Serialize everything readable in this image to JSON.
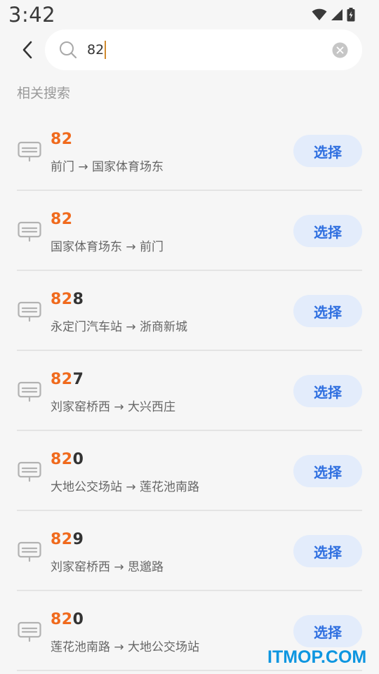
{
  "status_bar": {
    "time": "3:42"
  },
  "search": {
    "value": "82"
  },
  "section_title": "相关搜索",
  "select_label": "选择",
  "routes": [
    {
      "match": "82",
      "rest": "",
      "desc": "前门 → 国家体育场东"
    },
    {
      "match": "82",
      "rest": "",
      "desc": "国家体育场东 → 前门"
    },
    {
      "match": "82",
      "rest": "8",
      "desc": "永定门汽车站 → 浙商新城"
    },
    {
      "match": "82",
      "rest": "7",
      "desc": "刘家窑桥西 → 大兴西庄"
    },
    {
      "match": "82",
      "rest": "0",
      "desc": "大地公交场站 → 莲花池南路"
    },
    {
      "match": "82",
      "rest": "9",
      "desc": "刘家窑桥西 → 思邈路"
    },
    {
      "match": "82",
      "rest": "0",
      "desc": "莲花池南路 → 大地公交场站"
    }
  ],
  "watermark": "ITMOP.COM",
  "colors": {
    "highlight": "#f06a1d",
    "button_bg": "#e3ecfb",
    "button_text": "#2f6fe0",
    "background": "#f6f6f6"
  }
}
